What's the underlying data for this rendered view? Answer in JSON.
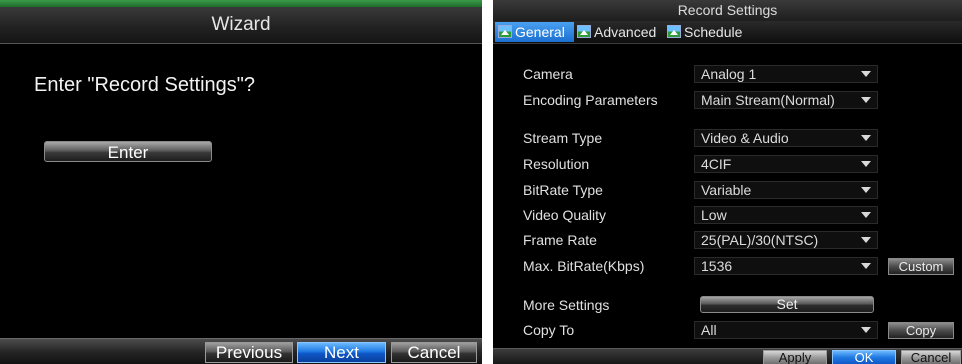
{
  "wizard": {
    "title": "Wizard",
    "prompt": "Enter \"Record Settings\"?",
    "enter_label": "Enter",
    "buttons": {
      "previous": "Previous",
      "next": "Next",
      "cancel": "Cancel"
    }
  },
  "record": {
    "title": "Record Settings",
    "tabs": [
      {
        "label": "General",
        "icon": "landscape-icon",
        "active": true
      },
      {
        "label": "Advanced",
        "icon": "landscape-icon",
        "active": false
      },
      {
        "label": "Schedule",
        "icon": "landscape-icon",
        "active": false
      }
    ],
    "fields": {
      "camera": {
        "label": "Camera",
        "value": "Analog 1"
      },
      "encoding": {
        "label": "Encoding Parameters",
        "value": "Main Stream(Normal)"
      },
      "stream_type": {
        "label": "Stream Type",
        "value": "Video & Audio"
      },
      "resolution": {
        "label": "Resolution",
        "value": "4CIF"
      },
      "bitrate_type": {
        "label": "BitRate Type",
        "value": "Variable"
      },
      "video_quality": {
        "label": "Video Quality",
        "value": "Low"
      },
      "frame_rate": {
        "label": "Frame Rate",
        "value": "25(PAL)/30(NTSC)"
      },
      "max_bitrate": {
        "label": "Max. BitRate(Kbps)",
        "value": "1536"
      },
      "more_settings": {
        "label": "More Settings"
      },
      "copy_to": {
        "label": "Copy To",
        "value": "All"
      }
    },
    "custom_label": "Custom",
    "set_label": "Set",
    "copy_label": "Copy",
    "buttons": {
      "apply": "Apply",
      "ok": "OK",
      "cancel": "Cancel"
    }
  },
  "colors": {
    "accent_blue": "#1f79e0",
    "title_green": "#2e8b3e",
    "background": "#000000"
  }
}
